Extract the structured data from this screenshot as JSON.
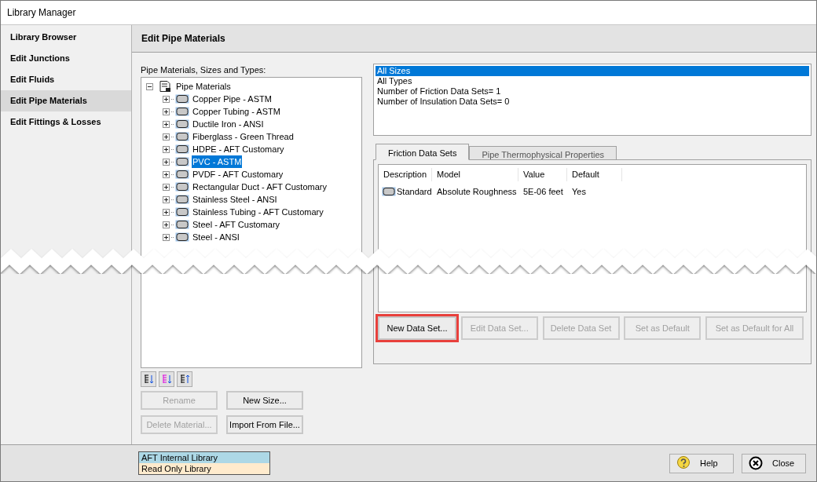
{
  "window": {
    "title": "Library Manager"
  },
  "sidebar": {
    "items": [
      {
        "label": "Library Browser",
        "selected": false
      },
      {
        "label": "Edit Junctions",
        "selected": false
      },
      {
        "label": "Edit Fluids",
        "selected": false
      },
      {
        "label": "Edit Pipe Materials",
        "selected": true
      },
      {
        "label": "Edit Fittings & Losses",
        "selected": false
      }
    ]
  },
  "header": {
    "title": "Edit Pipe Materials"
  },
  "tree": {
    "label": "Pipe Materials, Sizes and Types:",
    "root": {
      "label": "Pipe Materials",
      "expanded": true,
      "children": [
        {
          "label": "Copper Pipe - ASTM",
          "expanded": false,
          "selected": false
        },
        {
          "label": "Copper Tubing - ASTM",
          "expanded": false,
          "selected": false
        },
        {
          "label": "Ductile Iron - ANSI",
          "expanded": false,
          "selected": false
        },
        {
          "label": "Fiberglass - Green Thread",
          "expanded": false,
          "selected": false
        },
        {
          "label": "HDPE - AFT Customary",
          "expanded": false,
          "selected": false
        },
        {
          "label": "PVC - ASTM",
          "expanded": false,
          "selected": true
        },
        {
          "label": "PVDF - AFT Customary",
          "expanded": false,
          "selected": false
        },
        {
          "label": "Rectangular Duct - AFT Customary",
          "expanded": false,
          "selected": false
        },
        {
          "label": "Stainless Steel - ANSI",
          "expanded": false,
          "selected": false
        },
        {
          "label": "Stainless Tubing - AFT Customary",
          "expanded": false,
          "selected": false
        },
        {
          "label": "Steel - AFT Customary",
          "expanded": false,
          "selected": false
        },
        {
          "label": "Steel - ANSI",
          "expanded": false,
          "selected": false
        }
      ]
    }
  },
  "info_list": [
    {
      "label": "All Sizes",
      "selected": true
    },
    {
      "label": "All Types",
      "selected": false
    },
    {
      "label": "Number of Friction Data Sets= 1",
      "selected": false
    },
    {
      "label": "Number of Insulation Data Sets= 0",
      "selected": false
    }
  ],
  "tabs": [
    {
      "label": "Friction Data Sets",
      "selected": true
    },
    {
      "label": "Pipe Thermophysical Properties",
      "selected": false
    }
  ],
  "table": {
    "columns": [
      "Description",
      "Model",
      "Value",
      "Default"
    ],
    "rows": [
      [
        "Standard",
        "Absolute Roughness",
        "5E-06 feet",
        "Yes"
      ]
    ]
  },
  "data_set_buttons": [
    {
      "label": "New Data Set...",
      "disabled": false,
      "highlighted": true
    },
    {
      "label": "Edit Data Set...",
      "disabled": true,
      "highlighted": false
    },
    {
      "label": "Delete Data Set",
      "disabled": true,
      "highlighted": false
    },
    {
      "label": "Set as Default",
      "disabled": true,
      "highlighted": false
    },
    {
      "label": "Set as Default for All",
      "disabled": true,
      "highlighted": false
    }
  ],
  "tree_buttons": [
    {
      "label": "Rename",
      "disabled": true
    },
    {
      "label": "New Size...",
      "disabled": false
    },
    {
      "label": "Delete Material...",
      "disabled": true
    },
    {
      "label": "Import From File...",
      "disabled": false
    }
  ],
  "legend": [
    {
      "label": "AFT Internal Library",
      "color": "#add8e6"
    },
    {
      "label": "Read Only Library",
      "color": "#ffebcd"
    }
  ],
  "footer_buttons": [
    {
      "label": "Help",
      "kind": "help"
    },
    {
      "label": "Close",
      "kind": "close"
    }
  ]
}
